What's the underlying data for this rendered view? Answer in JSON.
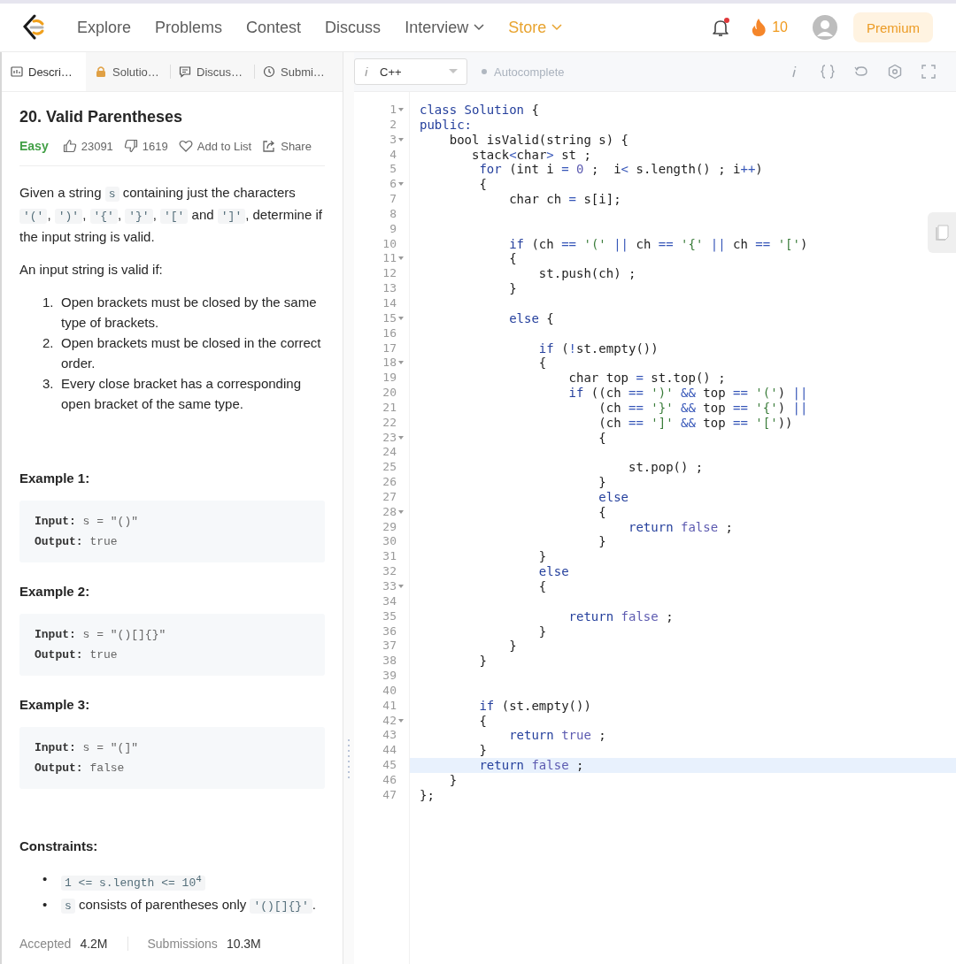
{
  "nav": {
    "items": [
      {
        "label": "Explore",
        "color": "#5c5c5c",
        "dropdown": false
      },
      {
        "label": "Problems",
        "color": "#5c5c5c",
        "dropdown": false
      },
      {
        "label": "Contest",
        "color": "#5c5c5c",
        "dropdown": false
      },
      {
        "label": "Discuss",
        "color": "#5c5c5c",
        "dropdown": false
      },
      {
        "label": "Interview",
        "color": "#5c5c5c",
        "dropdown": true
      },
      {
        "label": "Store",
        "color": "#e8a32e",
        "dropdown": true
      }
    ],
    "has_notification": true,
    "streak": "10",
    "premium": "Premium"
  },
  "tabs": [
    {
      "label": "Descri…",
      "selected": true
    },
    {
      "label": "Solutio…",
      "selected": false
    },
    {
      "label": "Discus…",
      "selected": false
    },
    {
      "label": "Submi…",
      "selected": false
    }
  ],
  "problem": {
    "title": "20. Valid Parentheses",
    "difficulty": "Easy",
    "likes": "23091",
    "dislikes": "1619",
    "add_to_list": "Add to List",
    "share": "Share",
    "paragraphs": [
      [
        {
          "kind": "text",
          "text": "Given a string "
        },
        {
          "kind": "code",
          "text": "s"
        },
        {
          "kind": "text",
          "text": " containing just the characters "
        },
        {
          "kind": "code",
          "text": "'('"
        },
        {
          "kind": "text",
          "text": ", "
        },
        {
          "kind": "code",
          "text": "')'"
        },
        {
          "kind": "text",
          "text": ", "
        },
        {
          "kind": "code",
          "text": "'{'"
        },
        {
          "kind": "text",
          "text": ", "
        },
        {
          "kind": "code",
          "text": "'}'"
        },
        {
          "kind": "text",
          "text": ", "
        },
        {
          "kind": "code",
          "text": "'['"
        },
        {
          "kind": "text",
          "text": " and "
        },
        {
          "kind": "code",
          "text": "']'"
        },
        {
          "kind": "text",
          "text": ", determine if the input string is valid."
        }
      ],
      [
        {
          "kind": "text",
          "text": "An input string is valid if:"
        }
      ]
    ],
    "rules": [
      {
        "marker": "1.",
        "text": "Open brackets must be closed by the same type of brackets."
      },
      {
        "marker": "2.",
        "text": "Open brackets must be closed in the correct order."
      },
      {
        "marker": "3.",
        "text": "Every close bracket has a corresponding open bracket of the same type."
      }
    ],
    "examples": [
      {
        "title": "Example 1:",
        "lines": [
          "**Input:** s = \"()\"",
          "**Output:** true"
        ]
      },
      {
        "title": "Example 2:",
        "lines": [
          "**Input:** s = \"()[]{}\"",
          "**Output:** true"
        ]
      },
      {
        "title": "Example 3:",
        "lines": [
          "**Input:** s = \"(]\"",
          "**Output:** false"
        ]
      }
    ],
    "constraints_title": "Constraints:",
    "constraints": [
      {
        "marker": "•",
        "parts": [
          {
            "kind": "code",
            "text": "1 <= s.length <= 10$^{4}$"
          }
        ]
      },
      {
        "marker": "•",
        "parts": [
          {
            "kind": "code",
            "text": "s"
          },
          {
            "kind": "text",
            "text": " consists of parentheses only "
          },
          {
            "kind": "code",
            "text": "'()[]{}'"
          },
          {
            "kind": "text",
            "text": "."
          }
        ]
      }
    ],
    "stats": [
      {
        "label": "Accepted",
        "value": "4.2M"
      },
      {
        "label": "Submissions",
        "value": "10.3M"
      }
    ]
  },
  "editor": {
    "language": "C++",
    "autocomplete": {
      "label": "Autocomplete",
      "enabled": false
    },
    "lines": [
      {
        "n": "1",
        "fold": true,
        "active": false,
        "tokens": [
          {
            "kind": "keyword",
            "text": "class Solution"
          },
          {
            "kind": "plain",
            "text": " {"
          }
        ]
      },
      {
        "n": "2",
        "fold": false,
        "active": false,
        "tokens": [
          {
            "kind": "keyword",
            "text": "public:"
          }
        ]
      },
      {
        "n": "3",
        "fold": true,
        "active": false,
        "tokens": [
          {
            "kind": "plain",
            "text": "    bool isValid(string s) {"
          }
        ]
      },
      {
        "n": "4",
        "fold": false,
        "active": false,
        "tokens": [
          {
            "kind": "plain",
            "text": "       stack"
          },
          {
            "kind": "operator",
            "text": "<"
          },
          {
            "kind": "plain",
            "text": "char"
          },
          {
            "kind": "operator",
            "text": ">"
          },
          {
            "kind": "plain",
            "text": " st ;"
          }
        ]
      },
      {
        "n": "5",
        "fold": false,
        "active": false,
        "tokens": [
          {
            "kind": "keyword",
            "text": "        for"
          },
          {
            "kind": "plain",
            "text": " (int i "
          },
          {
            "kind": "operator",
            "text": "="
          },
          {
            "kind": "literal",
            "text": " 0"
          },
          {
            "kind": "plain",
            "text": " ;  i"
          },
          {
            "kind": "operator",
            "text": "<"
          },
          {
            "kind": "plain",
            "text": " s.length() ; i"
          },
          {
            "kind": "operator",
            "text": "++"
          },
          {
            "kind": "plain",
            "text": ")"
          }
        ]
      },
      {
        "n": "6",
        "fold": true,
        "active": false,
        "tokens": [
          {
            "kind": "plain",
            "text": "        {"
          }
        ]
      },
      {
        "n": "7",
        "fold": false,
        "active": false,
        "tokens": [
          {
            "kind": "plain",
            "text": "            char ch "
          },
          {
            "kind": "operator",
            "text": "="
          },
          {
            "kind": "plain",
            "text": " s[i];"
          }
        ]
      },
      {
        "n": "8",
        "fold": false,
        "active": false
      },
      {
        "n": "9",
        "fold": false,
        "active": false
      },
      {
        "n": "10",
        "fold": false,
        "active": false,
        "tokens": [
          {
            "kind": "keyword",
            "text": "            if"
          },
          {
            "kind": "plain",
            "text": " (ch "
          },
          {
            "kind": "operator",
            "text": "=="
          },
          {
            "kind": "string",
            "text": " '('"
          },
          {
            "kind": "operator",
            "text": " ||"
          },
          {
            "kind": "plain",
            "text": " ch "
          },
          {
            "kind": "operator",
            "text": "=="
          },
          {
            "kind": "string",
            "text": " '{'"
          },
          {
            "kind": "operator",
            "text": " ||"
          },
          {
            "kind": "plain",
            "text": " ch "
          },
          {
            "kind": "operator",
            "text": "=="
          },
          {
            "kind": "string",
            "text": " '['"
          },
          {
            "kind": "plain",
            "text": ")"
          }
        ]
      },
      {
        "n": "11",
        "fold": true,
        "active": false,
        "tokens": [
          {
            "kind": "plain",
            "text": "            {"
          }
        ]
      },
      {
        "n": "12",
        "fold": false,
        "active": false,
        "tokens": [
          {
            "kind": "plain",
            "text": "                st.push(ch) ;"
          }
        ]
      },
      {
        "n": "13",
        "fold": false,
        "active": false,
        "tokens": [
          {
            "kind": "plain",
            "text": "            }"
          }
        ]
      },
      {
        "n": "14",
        "fold": false,
        "active": false
      },
      {
        "n": "15",
        "fold": true,
        "active": false,
        "tokens": [
          {
            "kind": "keyword",
            "text": "            else"
          },
          {
            "kind": "plain",
            "text": " {"
          }
        ]
      },
      {
        "n": "16",
        "fold": false,
        "active": false
      },
      {
        "n": "17",
        "fold": false,
        "active": false,
        "tokens": [
          {
            "kind": "keyword",
            "text": "                if"
          },
          {
            "kind": "plain",
            "text": " ("
          },
          {
            "kind": "operator",
            "text": "!"
          },
          {
            "kind": "plain",
            "text": "st.empty())"
          }
        ]
      },
      {
        "n": "18",
        "fold": true,
        "active": false,
        "tokens": [
          {
            "kind": "plain",
            "text": "                {"
          }
        ]
      },
      {
        "n": "19",
        "fold": false,
        "active": false,
        "tokens": [
          {
            "kind": "plain",
            "text": "                    char top "
          },
          {
            "kind": "operator",
            "text": "="
          },
          {
            "kind": "plain",
            "text": " st.top() ;"
          }
        ]
      },
      {
        "n": "20",
        "fold": false,
        "active": false,
        "tokens": [
          {
            "kind": "keyword",
            "text": "                    if"
          },
          {
            "kind": "plain",
            "text": " ((ch "
          },
          {
            "kind": "operator",
            "text": "=="
          },
          {
            "kind": "string",
            "text": " ')'"
          },
          {
            "kind": "operator",
            "text": " &&"
          },
          {
            "kind": "plain",
            "text": " top "
          },
          {
            "kind": "operator",
            "text": "=="
          },
          {
            "kind": "string",
            "text": " '('"
          },
          {
            "kind": "plain",
            "text": ") "
          },
          {
            "kind": "operator",
            "text": "||"
          }
        ]
      },
      {
        "n": "21",
        "fold": false,
        "active": false,
        "tokens": [
          {
            "kind": "plain",
            "text": "                        (ch "
          },
          {
            "kind": "operator",
            "text": "=="
          },
          {
            "kind": "string",
            "text": " '}'"
          },
          {
            "kind": "operator",
            "text": " &&"
          },
          {
            "kind": "plain",
            "text": " top "
          },
          {
            "kind": "operator",
            "text": "=="
          },
          {
            "kind": "string",
            "text": " '{'"
          },
          {
            "kind": "plain",
            "text": ") "
          },
          {
            "kind": "operator",
            "text": "||"
          }
        ]
      },
      {
        "n": "22",
        "fold": false,
        "active": false,
        "tokens": [
          {
            "kind": "plain",
            "text": "                        (ch "
          },
          {
            "kind": "operator",
            "text": "=="
          },
          {
            "kind": "string",
            "text": " ']'"
          },
          {
            "kind": "operator",
            "text": " &&"
          },
          {
            "kind": "plain",
            "text": " top "
          },
          {
            "kind": "operator",
            "text": "=="
          },
          {
            "kind": "string",
            "text": " '['"
          },
          {
            "kind": "plain",
            "text": "))"
          }
        ]
      },
      {
        "n": "23",
        "fold": true,
        "active": false,
        "tokens": [
          {
            "kind": "plain",
            "text": "                        {"
          }
        ]
      },
      {
        "n": "24",
        "fold": false,
        "active": false
      },
      {
        "n": "25",
        "fold": false,
        "active": false,
        "tokens": [
          {
            "kind": "plain",
            "text": "                            st.pop() ;"
          }
        ]
      },
      {
        "n": "26",
        "fold": false,
        "active": false,
        "tokens": [
          {
            "kind": "plain",
            "text": "                        }"
          }
        ]
      },
      {
        "n": "27",
        "fold": false,
        "active": false,
        "tokens": [
          {
            "kind": "keyword",
            "text": "                        else"
          }
        ]
      },
      {
        "n": "28",
        "fold": true,
        "active": false,
        "tokens": [
          {
            "kind": "plain",
            "text": "                        {"
          }
        ]
      },
      {
        "n": "29",
        "fold": false,
        "active": false,
        "tokens": [
          {
            "kind": "keyword",
            "text": "                            return"
          },
          {
            "kind": "literal",
            "text": " false"
          },
          {
            "kind": "plain",
            "text": " ;"
          }
        ]
      },
      {
        "n": "30",
        "fold": false,
        "active": false,
        "tokens": [
          {
            "kind": "plain",
            "text": "                        }"
          }
        ]
      },
      {
        "n": "31",
        "fold": false,
        "active": false,
        "tokens": [
          {
            "kind": "plain",
            "text": "                }"
          }
        ]
      },
      {
        "n": "32",
        "fold": false,
        "active": false,
        "tokens": [
          {
            "kind": "keyword",
            "text": "                else"
          }
        ]
      },
      {
        "n": "33",
        "fold": true,
        "active": false,
        "tokens": [
          {
            "kind": "plain",
            "text": "                {"
          }
        ]
      },
      {
        "n": "34",
        "fold": false,
        "active": false
      },
      {
        "n": "35",
        "fold": false,
        "active": false,
        "tokens": [
          {
            "kind": "keyword",
            "text": "                    return"
          },
          {
            "kind": "literal",
            "text": " false"
          },
          {
            "kind": "plain",
            "text": " ;"
          }
        ]
      },
      {
        "n": "36",
        "fold": false,
        "active": false,
        "tokens": [
          {
            "kind": "plain",
            "text": "                }"
          }
        ]
      },
      {
        "n": "37",
        "fold": false,
        "active": false,
        "tokens": [
          {
            "kind": "plain",
            "text": "            }"
          }
        ]
      },
      {
        "n": "38",
        "fold": false,
        "active": false,
        "tokens": [
          {
            "kind": "plain",
            "text": "        }"
          }
        ]
      },
      {
        "n": "39",
        "fold": false,
        "active": false
      },
      {
        "n": "40",
        "fold": false,
        "active": false
      },
      {
        "n": "41",
        "fold": false,
        "active": false,
        "tokens": [
          {
            "kind": "keyword",
            "text": "        if"
          },
          {
            "kind": "plain",
            "text": " (st.empty())"
          }
        ]
      },
      {
        "n": "42",
        "fold": true,
        "active": false,
        "tokens": [
          {
            "kind": "plain",
            "text": "        {"
          }
        ]
      },
      {
        "n": "43",
        "fold": false,
        "active": false,
        "tokens": [
          {
            "kind": "keyword",
            "text": "            return"
          },
          {
            "kind": "literal",
            "text": " true"
          },
          {
            "kind": "plain",
            "text": " ;"
          }
        ]
      },
      {
        "n": "44",
        "fold": false,
        "active": false,
        "tokens": [
          {
            "kind": "plain",
            "text": "        }"
          }
        ]
      },
      {
        "n": "45",
        "fold": false,
        "active": true,
        "tokens": [
          {
            "kind": "keyword",
            "text": "        return"
          },
          {
            "kind": "literal",
            "text": " false"
          },
          {
            "kind": "plain",
            "text": " ;"
          }
        ]
      },
      {
        "n": "46",
        "fold": false,
        "active": false,
        "tokens": [
          {
            "kind": "plain",
            "text": "    }"
          }
        ]
      },
      {
        "n": "47",
        "fold": false,
        "active": false,
        "tokens": [
          {
            "kind": "plain",
            "text": "};"
          }
        ]
      }
    ]
  }
}
